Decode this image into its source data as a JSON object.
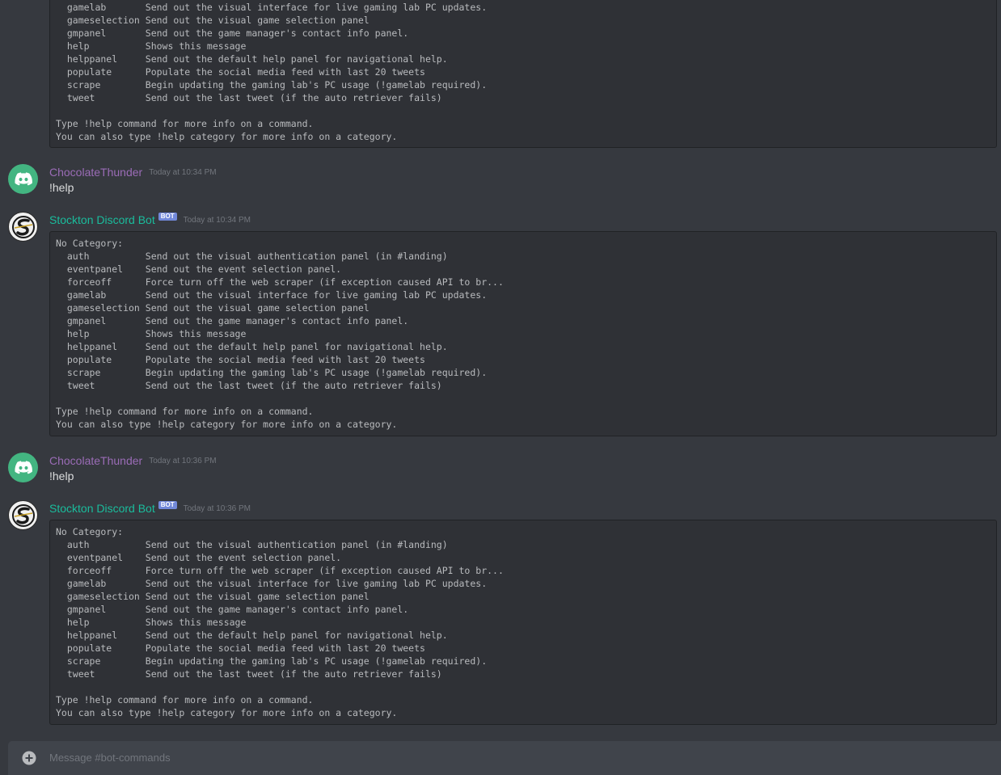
{
  "top_block": {
    "lines": [
      "  gamelab       Send out the visual interface for live gaming lab PC updates.",
      "  gameselection Send out the visual game selection panel",
      "  gmpanel       Send out the game manager's contact info panel.",
      "  help          Shows this message",
      "  helppanel     Send out the default help panel for navigational help.",
      "  populate      Populate the social media feed with last 20 tweets",
      "  scrape        Begin updating the gaming lab's PC usage (!gamelab required).",
      "  tweet         Send out the last tweet (if the auto retriever fails)",
      "",
      "Type !help command for more info on a command.",
      "You can also type !help category for more info on a category."
    ]
  },
  "messages": [
    {
      "author": "ChocolateThunder",
      "author_type": "user",
      "timestamp": "Today at 10:34 PM",
      "text": "!help"
    },
    {
      "author": "Stockton Discord Bot",
      "author_type": "bot",
      "badge": "BOT",
      "timestamp": "Today at 10:34 PM",
      "code_lines": [
        "No Category:",
        "  auth          Send out the visual authentication panel (in #landing)",
        "  eventpanel    Send out the event selection panel.",
        "  forceoff      Force turn off the web scraper (if exception caused API to br...",
        "  gamelab       Send out the visual interface for live gaming lab PC updates.",
        "  gameselection Send out the visual game selection panel",
        "  gmpanel       Send out the game manager's contact info panel.",
        "  help          Shows this message",
        "  helppanel     Send out the default help panel for navigational help.",
        "  populate      Populate the social media feed with last 20 tweets",
        "  scrape        Begin updating the gaming lab's PC usage (!gamelab required).",
        "  tweet         Send out the last tweet (if the auto retriever fails)",
        "",
        "Type !help command for more info on a command.",
        "You can also type !help category for more info on a category."
      ]
    },
    {
      "author": "ChocolateThunder",
      "author_type": "user",
      "timestamp": "Today at 10:36 PM",
      "text": "!help"
    },
    {
      "author": "Stockton Discord Bot",
      "author_type": "bot",
      "badge": "BOT",
      "timestamp": "Today at 10:36 PM",
      "code_lines": [
        "No Category:",
        "  auth          Send out the visual authentication panel (in #landing)",
        "  eventpanel    Send out the event selection panel.",
        "  forceoff      Force turn off the web scraper (if exception caused API to br...",
        "  gamelab       Send out the visual interface for live gaming lab PC updates.",
        "  gameselection Send out the visual game selection panel",
        "  gmpanel       Send out the game manager's contact info panel.",
        "  help          Shows this message",
        "  helppanel     Send out the default help panel for navigational help.",
        "  populate      Populate the social media feed with last 20 tweets",
        "  scrape        Begin updating the gaming lab's PC usage (!gamelab required).",
        "  tweet         Send out the last tweet (if the auto retriever fails)",
        "",
        "Type !help command for more info on a command.",
        "You can also type !help category for more info on a category."
      ]
    }
  ],
  "composer": {
    "placeholder": "Message #bot-commands",
    "icon": "plus-circle-icon"
  },
  "colors": {
    "background": "#36393f",
    "code_bg": "#2f3136",
    "user_name": "#9b6cb7",
    "bot_name": "#1abc9c",
    "badge": "#7289da",
    "avatar_user": "#43b581"
  }
}
